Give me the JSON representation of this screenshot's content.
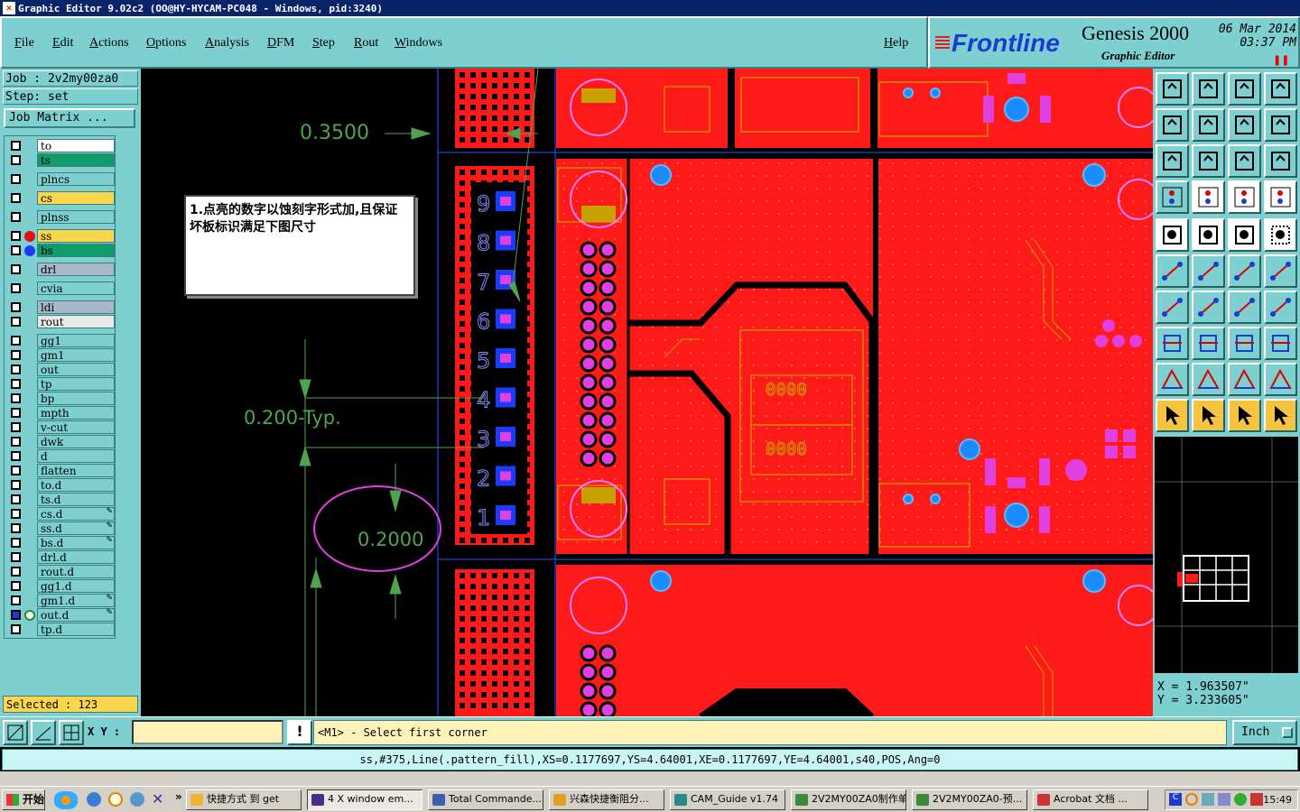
{
  "window": {
    "title": "Graphic Editor 9.02c2 (OO@HY-HYCAM-PC048 - Windows, pid:3240)"
  },
  "menu": {
    "items": [
      "File",
      "Edit",
      "Actions",
      "Options",
      "Analysis",
      "DFM",
      "Step",
      "Rout",
      "Windows"
    ],
    "help": "Help"
  },
  "brand": {
    "logo": "Frontline",
    "product": "Genesis 2000",
    "subtitle": "Graphic Editor",
    "date": "06 Mar 2014",
    "time": "03:37 PM"
  },
  "job": {
    "job_label": "Job : 2v2my00za0",
    "step_label": "Step: set",
    "job_matrix": "Job Matrix ..."
  },
  "layers": [
    {
      "name": "to",
      "color": "#ffffff"
    },
    {
      "name": "ts",
      "color": "#0f9c6a"
    },
    {
      "name": "plncs",
      "color": "#7ed0d0"
    },
    {
      "name": "cs",
      "color": "#fbd54c"
    },
    {
      "name": "plnss",
      "color": "#7ed0d0"
    },
    {
      "name": "ss",
      "color": "#fbd54c",
      "dot": "#e01010"
    },
    {
      "name": "bs",
      "color": "#0f9c6a",
      "dot": "#1a3cff"
    },
    {
      "name": "drl",
      "color": "#a8b8c8"
    },
    {
      "name": "cvia",
      "color": "#7ed0d0"
    },
    {
      "name": "ldi",
      "color": "#a8b8c8"
    },
    {
      "name": "rout",
      "color": "#e8e8e8"
    },
    {
      "name": "gg1",
      "color": "#7ed0d0"
    },
    {
      "name": "gm1",
      "color": "#7ed0d0"
    },
    {
      "name": "out",
      "color": "#7ed0d0"
    },
    {
      "name": "tp",
      "color": "#7ed0d0"
    },
    {
      "name": "bp",
      "color": "#7ed0d0"
    },
    {
      "name": "mpth",
      "color": "#7ed0d0"
    },
    {
      "name": "v-cut",
      "color": "#7ed0d0"
    },
    {
      "name": "dwk",
      "color": "#7ed0d0"
    },
    {
      "name": "d",
      "color": "#7ed0d0"
    },
    {
      "name": "flatten",
      "color": "#7ed0d0"
    },
    {
      "name": "to.d",
      "color": "#7ed0d0"
    },
    {
      "name": "ts.d",
      "color": "#7ed0d0"
    },
    {
      "name": "cs.d",
      "color": "#7ed0d0",
      "edit": true
    },
    {
      "name": "ss.d",
      "color": "#7ed0d0",
      "edit": true
    },
    {
      "name": "bs.d",
      "color": "#7ed0d0",
      "edit": true
    },
    {
      "name": "drl.d",
      "color": "#7ed0d0"
    },
    {
      "name": "rout.d",
      "color": "#7ed0d0"
    },
    {
      "name": "gg1.d",
      "color": "#7ed0d0"
    },
    {
      "name": "gm1.d",
      "color": "#7ed0d0",
      "edit": true
    },
    {
      "name": "out.d",
      "color": "#7ed0d0",
      "edit": true,
      "active": true
    },
    {
      "name": "tp.d",
      "color": "#7ed0d0"
    }
  ],
  "selected": "Selected : 123",
  "canvas": {
    "note": "1.点亮的数字以蚀刻字形式加,且保证坏板标识满足下图尺寸",
    "dim_top": "0.3500",
    "dim_mid": "0.200-Typ.",
    "dim_bottom": "0.2000",
    "digits": [
      "9",
      "8",
      "7",
      "6",
      "5",
      "4",
      "3",
      "2",
      "1"
    ],
    "chip_label": "0000"
  },
  "colors": {
    "copper": "#ff1a1a",
    "outline": "#c8a000",
    "pad": "#e040e0",
    "via": "#1a8cff",
    "dim": "#4fa34f",
    "panel": "#7ed0d0",
    "highlight": "#fbd54c"
  },
  "coords": {
    "x": "X = 1.963507\"",
    "y": "Y = 3.233605\""
  },
  "command": {
    "xy_label": "X Y :",
    "xy_value": "",
    "prompt": "<M1> - Select first corner",
    "units": "Inch"
  },
  "feature_line": "ss,#375,Line(.pattern_fill),XS=0.1177697,YS=4.64001,XE=0.1177697,YE=4.64001,s40,POS,Ang=0",
  "taskbar": {
    "start": "开始",
    "tasks": [
      "快捷方式 到 get",
      "4 X window em...",
      "Total Commande...",
      "兴森快捷衡阻分...",
      "CAM_Guide v1.74",
      "2V2MY00ZA0制作单",
      "2V2MY00ZA0-预...",
      "Acrobat 文档 ..."
    ],
    "clock": "15:49"
  },
  "toolbar_icons": [
    "home-icon",
    "download-icon",
    "house-icon",
    "window-split-icon",
    "import-icon",
    "export-icon",
    "swap-icon",
    "s-curve-icon",
    "fit-icon",
    "zoom-all-icon",
    "ratio-icon",
    "help-icon",
    "ruler-tool-icon",
    "grid-icon",
    "layer-pads-icon",
    "layer-pads-alt-icon",
    "circle-fill-icon",
    "shape-edit-icon",
    "measure-icon",
    "dotted-square-icon",
    "connect-icon",
    "cross-icon",
    "node-icon",
    "node-add-icon",
    "angle-icon",
    "line-icon",
    "arc-icon",
    "split-icon",
    "pad-move-icon",
    "dash-icon",
    "resize-icon",
    "move-objects-icon",
    "triangle-icon",
    "triangle-a-icon",
    "arc-a-icon",
    "arc-a-alt-icon",
    "select-pointer-icon",
    "select-box-icon",
    "select-pointer-alt-icon",
    "route-icon"
  ]
}
